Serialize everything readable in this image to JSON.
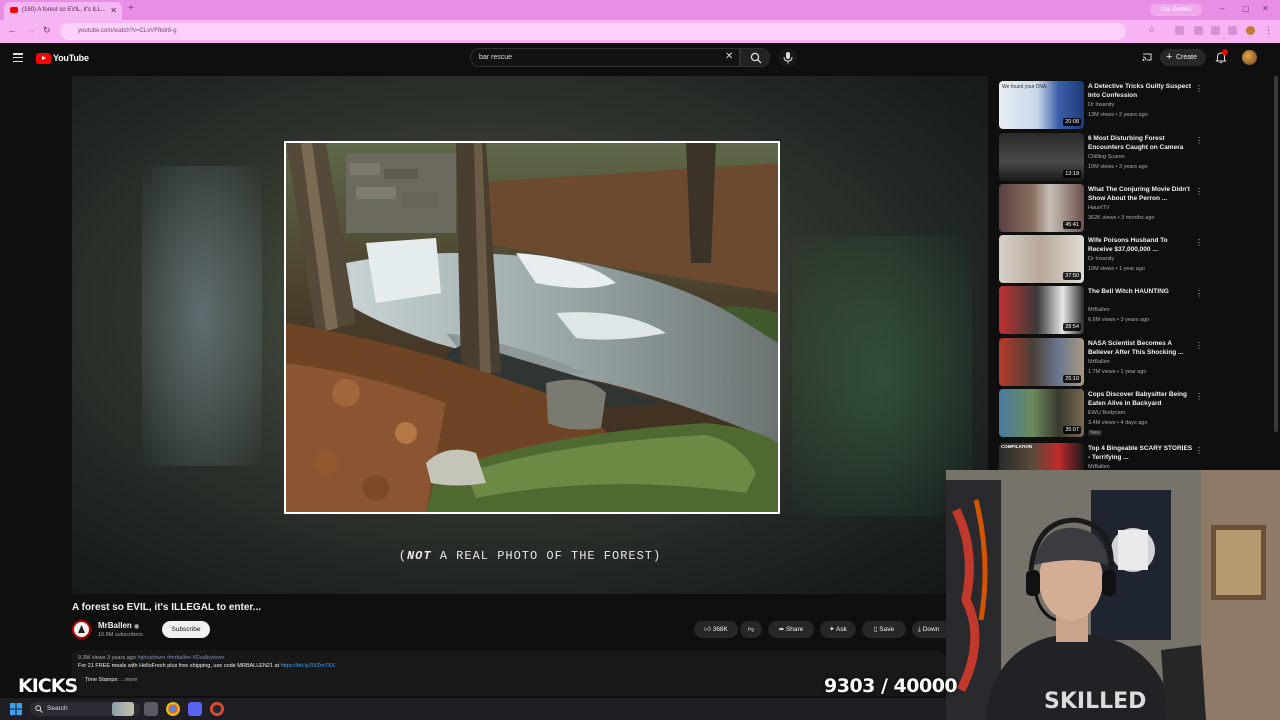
{
  "browser": {
    "tab_title": "(160) A forest so EVIL, it's ILL...",
    "url": "youtube.com/watch?v=CLxVFfkdr8-g",
    "ask_gemini": "Ask Gemini"
  },
  "youtube": {
    "logo_text": "YouTube",
    "search_query": "bar rescue",
    "create_label": "Create"
  },
  "video": {
    "caption_emph": "NOT",
    "caption_open": "(",
    "caption_rest": " A REAL PHOTO OF THE FOREST)",
    "title": "A forest so EVIL, it's ILLEGAL to enter...",
    "channel": "MrBallen",
    "subscribers": "10.8M subscribers",
    "subscribe_label": "Subscribe",
    "likes": "368K",
    "share_label": "Share",
    "ask_label": "Ask",
    "save_label": "Save",
    "download_label": "Down",
    "description_meta": "9.3M views  3 years ago",
    "description_tags": "#ghosttown #mrballen #Dudleytown",
    "description_text": "For 21 FREE meals with HelloFresh plus free shipping, use code MRBALLEN21 at",
    "description_link": "https://bit.ly/3VZm7XX",
    "description_line3": "Time Stamps:",
    "more_label": "...more"
  },
  "recommendations": [
    {
      "title": "A Detective Tricks Guilty Suspect Into Confession",
      "channel": "Dr Insanity",
      "meta": "13M views • 2 years ago",
      "duration": "20:08",
      "thumb_text": "We found your DNA"
    },
    {
      "title": "6 Most Disturbing Forest Encounters Caught on Camera",
      "channel": "Chilling Scares",
      "meta": "10M views • 3 years ago",
      "duration": "13:19",
      "thumb_text": ""
    },
    {
      "title": "What The Conjuring Movie Didn't Show About the Perron ...",
      "channel": "HauntTV",
      "meta": "362K views • 3 months ago",
      "duration": "45:41",
      "thumb_text": ""
    },
    {
      "title": "Wife Poisons Husband To Receive $37,000,000 ...",
      "channel": "Dr Insanity",
      "meta": "10M views • 1 year ago",
      "duration": "37:50",
      "thumb_text": ""
    },
    {
      "title": "The Bell Witch HAUNTING",
      "channel": "MrBallen",
      "meta": "6.6M views • 3 years ago",
      "duration": "28:54",
      "thumb_text": ""
    },
    {
      "title": "NASA Scientist Becomes A Believer After This Shocking ...",
      "channel": "MrBallen",
      "meta": "1.7M views • 1 year ago",
      "duration": "25:10",
      "thumb_text": ""
    },
    {
      "title": "Cops Discover Babysitter Being Eaten Alive in Backyard",
      "channel": "EWU Bodycam",
      "meta": "3.4M views • 4 days ago",
      "duration": "35:07",
      "badge": "New",
      "thumb_text": ""
    },
    {
      "title": "Top 4 Bingeable SCARY STORIES - Terrifying ...",
      "channel": "MrBallen",
      "meta": "",
      "duration": "",
      "thumb_text": "COMPILATION"
    }
  ],
  "overlay": {
    "logo_text": "KICKS",
    "counter": "9303 / 40000"
  },
  "taskbar": {
    "search_label": "Search"
  },
  "colors": {
    "browser_pink": "#e88ee6",
    "youtube_red": "#ff0000",
    "background": "#0f0f0f"
  }
}
